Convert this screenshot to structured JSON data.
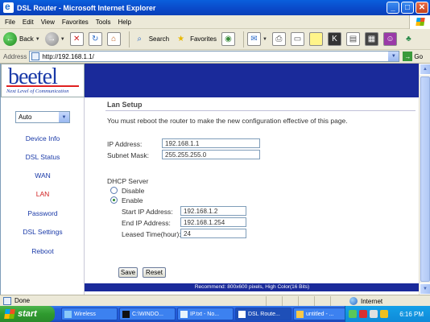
{
  "window": {
    "title": "DSL Router - Microsoft Internet Explorer",
    "minimize": "_",
    "maximize": "□",
    "close": "✕"
  },
  "menu": [
    "File",
    "Edit",
    "View",
    "Favorites",
    "Tools",
    "Help"
  ],
  "toolbar": {
    "back_label": "Back",
    "search_label": "Search",
    "favorites_label": "Favorites"
  },
  "address": {
    "label": "Address",
    "url": "http://192.168.1.1/",
    "go_label": "Go"
  },
  "logo": {
    "brand": "beetel",
    "tagline": "Next Level of Communication"
  },
  "sidebar": {
    "mode_select": "Auto",
    "items": [
      "Device Info",
      "DSL Status",
      "WAN",
      "LAN",
      "Password",
      "DSL Settings",
      "Reboot"
    ],
    "active": "LAN"
  },
  "lan": {
    "title": "Lan Setup",
    "message": "You must reboot the router to make the new configuration effective of this page.",
    "ip_label": "IP Address:",
    "ip_value": "192.168.1.1",
    "mask_label": "Subnet Mask:",
    "mask_value": "255.255.255.0",
    "dhcp_label": "DHCP Server",
    "disable_label": "Disable",
    "enable_label": "Enable",
    "dhcp_enabled": true,
    "start_label": "Start IP Address:",
    "start_value": "192.168.1.2",
    "end_label": "End IP Address:",
    "end_value": "192.168.1.254",
    "lease_label": "Leased Time(hour):",
    "lease_value": "24",
    "save_label": "Save",
    "reset_label": "Reset"
  },
  "footer": "Recommend: 800x600 pixels, High Color(16 Bits)",
  "status": {
    "left": "Done",
    "zone": "Internet"
  },
  "taskbar": {
    "start": "start",
    "tasks": [
      "Wireless",
      "C:\\WINDO...",
      "IP.txt - No...",
      "DSL Route...",
      "untitled - ..."
    ],
    "active_task": "DSL Route...",
    "clock": "6:16 PM"
  },
  "colors": {
    "brand_blue": "#1a2a9a",
    "nav_link": "#1a3aa8",
    "nav_active": "#d02020"
  }
}
